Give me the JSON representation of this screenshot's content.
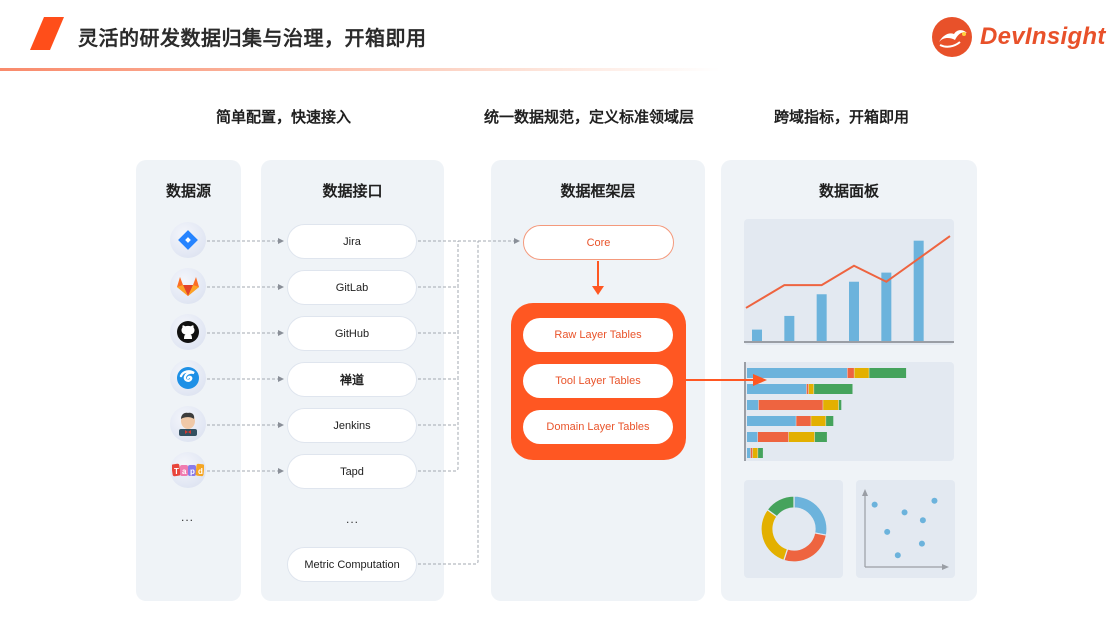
{
  "header": {
    "title": "灵活的研发数据归集与治理，开箱即用",
    "brand": "DevInsight",
    "accent_color": "#ff4e1a"
  },
  "subtitles": [
    "简单配置，快速接入",
    "统一数据规范，定义标准领域层",
    "跨域指标，开箱即用"
  ],
  "panels": {
    "sources": {
      "title": "数据源",
      "items": [
        {
          "name": "Jira",
          "icon": "jira-icon"
        },
        {
          "name": "GitLab",
          "icon": "gitlab-icon"
        },
        {
          "name": "GitHub",
          "icon": "github-icon"
        },
        {
          "name": "禅道",
          "icon": "zentao-icon"
        },
        {
          "name": "Jenkins",
          "icon": "jenkins-icon"
        },
        {
          "name": "Tapd",
          "icon": "tapd-icon"
        }
      ],
      "more": "..."
    },
    "interfaces": {
      "title": "数据接口",
      "items": [
        "Jira",
        "GitLab",
        "GitHub",
        "禅道",
        "Jenkins",
        "Tapd"
      ],
      "more": "...",
      "extra": "Metric Computation"
    },
    "framework": {
      "title": "数据框架层",
      "core": "Core",
      "layers": [
        "Raw Layer Tables",
        "Tool Layer Tables",
        "Domain Layer Tables"
      ],
      "layer_box_color": "#ff5722"
    },
    "dashboard": {
      "title": "数据面板",
      "bar_line_chart": {
        "type": "bar+line",
        "bars": [
          1,
          2.2,
          4.1,
          5.2,
          6,
          8.8
        ],
        "line": [
          2.9,
          4.9,
          4.9,
          6.6,
          5.2,
          9.2
        ],
        "bar_color": "#6cb3dc",
        "line_color": "#ee6440"
      },
      "stacked_bar_chart": {
        "type": "stacked-bar-horizontal",
        "colors": [
          "#6cb3dc",
          "#ee6440",
          "#e3b000",
          "#45a35c"
        ],
        "rows": [
          [
            125,
            8,
            18,
            46
          ],
          [
            74,
            2,
            6,
            48
          ],
          [
            14,
            80,
            19,
            3
          ],
          [
            61,
            18,
            18,
            9
          ],
          [
            13,
            38,
            32,
            15
          ],
          [
            4,
            2,
            6,
            6
          ]
        ]
      },
      "donut_chart": {
        "type": "pie",
        "values": [
          28,
          27,
          30,
          15
        ],
        "colors": [
          "#6cb3dc",
          "#ee6440",
          "#e3b000",
          "#45a35c"
        ]
      },
      "scatter_chart": {
        "type": "scatter",
        "points": [
          [
            1,
            8
          ],
          [
            2.3,
            4.5
          ],
          [
            3.4,
            1.5
          ],
          [
            4.1,
            7
          ],
          [
            6,
            6
          ],
          [
            5.9,
            3
          ],
          [
            7.2,
            8.5
          ]
        ],
        "color": "#6cb3dc"
      }
    }
  }
}
